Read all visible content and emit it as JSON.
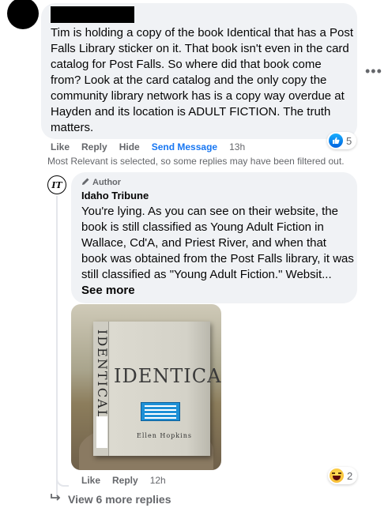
{
  "top_comment": {
    "text": "Tim is holding a copy of the book Identical that has a Post Falls Library sticker on it. That book isn't even in the card catalog for Post Falls. So where did that book come from? Look at the card catalog and the only copy the community library network has is a copy way overdue at Hayden and its location is ADULT FICTION. The truth matters.",
    "reactions": {
      "icon": "like-icon",
      "count": "5"
    },
    "actions": {
      "like": "Like",
      "reply": "Reply",
      "hide": "Hide",
      "send_message": "Send Message",
      "time": "13h"
    }
  },
  "filter_note": "Most Relevant is selected, so some replies may have been filtered out.",
  "reply": {
    "avatar_monogram": "IT",
    "badge": "Author",
    "author": "Idaho Tribune",
    "text": "You're lying. As you can see on their website, the book is still classified as Young Adult Fiction in Wallace, Cd'A, and Priest River, and when that book was obtained from the Post Falls library, it was still classified as \"Young Adult Fiction.\" Websit...",
    "see_more": "See more",
    "photo": {
      "spine_text": "IDENTICAL",
      "cover_title": "IDENTICAL",
      "cover_author": "Ellen Hopkins"
    },
    "reactions": {
      "icon": "haha-icon",
      "count": "2"
    },
    "actions": {
      "like": "Like",
      "reply": "Reply",
      "time": "12h"
    }
  },
  "view_more": "View 6 more replies",
  "colors": {
    "link_blue": "#1877f2",
    "bubble_gray": "#f0f2f5",
    "meta_gray": "#65676b"
  }
}
